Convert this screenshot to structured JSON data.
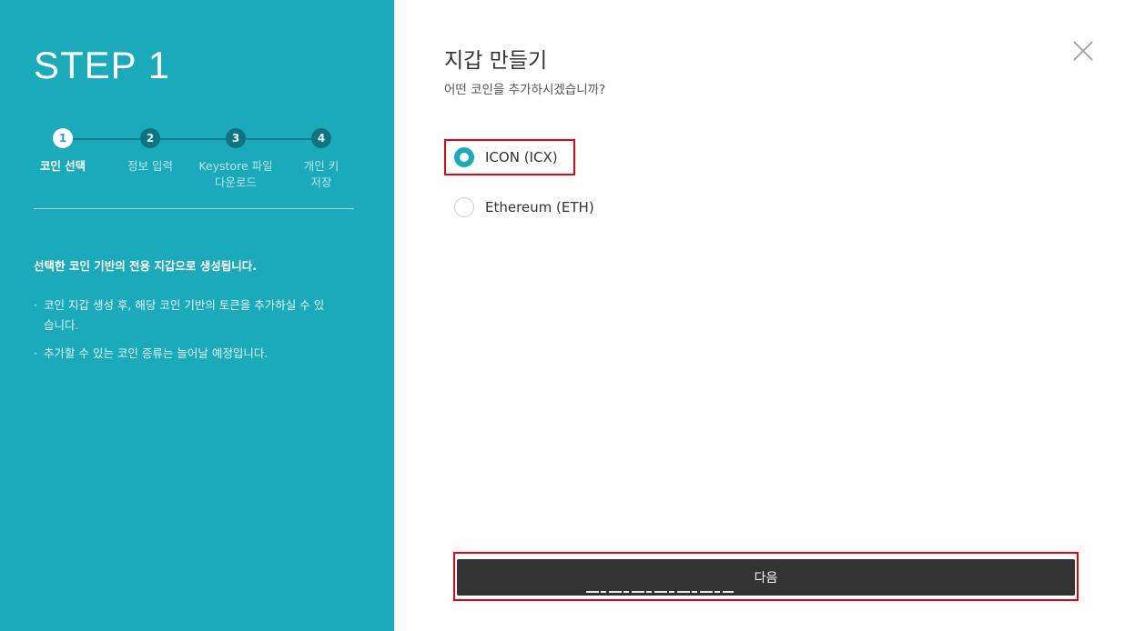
{
  "left": {
    "step_title": "STEP 1",
    "steps": [
      {
        "number": "1",
        "label": "코인 선택",
        "active": true
      },
      {
        "number": "2",
        "label": "정보 입력",
        "active": false
      },
      {
        "number": "3",
        "label": "Keystore 파일 다운로드",
        "active": false
      },
      {
        "number": "4",
        "label": "개인 키 저장",
        "active": false
      }
    ],
    "info_title": "선택한 코인 기반의 전용 지갑으로 생성됩니다.",
    "info_items": [
      "코인 지갑 생성 후, 해당 코인 기반의 토큰을 추가하실 수 있습니다.",
      "추가할 수 있는 코인 종류는 늘어날 예정입니다."
    ],
    "bullet": "·"
  },
  "main": {
    "title": "지갑 만들기",
    "subtitle": "어떤 코인을 추가하시겠습니까?",
    "options": [
      {
        "label": "ICON (ICX)",
        "selected": true
      },
      {
        "label": "Ethereum (ETH)",
        "selected": false
      }
    ],
    "next_label": "다음"
  },
  "colors": {
    "accent": "#1aaaba",
    "button_dark": "#333333",
    "highlight_border": "#e60012"
  },
  "icons": {
    "close": "close-icon",
    "radio": "radio-icon"
  }
}
